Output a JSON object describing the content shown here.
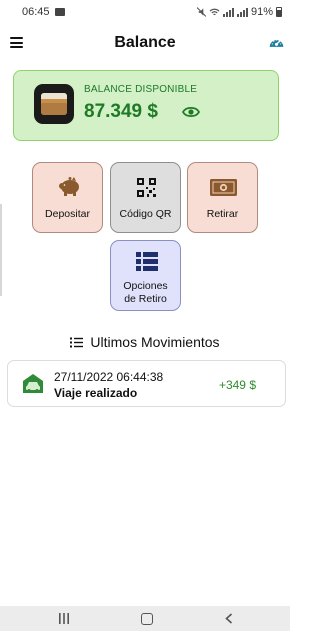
{
  "status_bar": {
    "time": "06:45",
    "battery": "91%"
  },
  "header": {
    "title": "Balance",
    "menu_icon": "hamburger-menu-icon",
    "right_icon": "speedometer-icon"
  },
  "balance": {
    "label": "BALANCE DISPONIBLE",
    "amount": "87.349 $",
    "icon": "wallet-icon",
    "visibility_icon": "eye-icon",
    "bg_color": "#d3f0c6",
    "border_color": "#8ed26f",
    "text_color": "#1f7a26"
  },
  "actions": [
    {
      "label": "Depositar",
      "icon": "piggy-bank-icon",
      "bg_color": "#f7ddd4"
    },
    {
      "label": "Código QR",
      "icon": "qr-code-icon",
      "bg_color": "#dedede"
    },
    {
      "label": "Retirar",
      "icon": "money-bill-icon",
      "bg_color": "#f7ddd4"
    },
    {
      "label_lines": [
        "Opciones",
        "de Retiro"
      ],
      "icon": "list-icon",
      "bg_color": "#dfe2fa"
    }
  ],
  "movements": {
    "title": "Ultimos Movimientos",
    "items": [
      {
        "date": "27/11/2022 06:44:38",
        "description": "Viaje realizado",
        "amount": "+349 $",
        "icon": "car-icon",
        "amount_color": "#2e8b2e"
      }
    ]
  },
  "nav": {
    "recent_icon": "recent-apps-icon",
    "home_icon": "home-icon",
    "back_icon": "back-icon"
  }
}
